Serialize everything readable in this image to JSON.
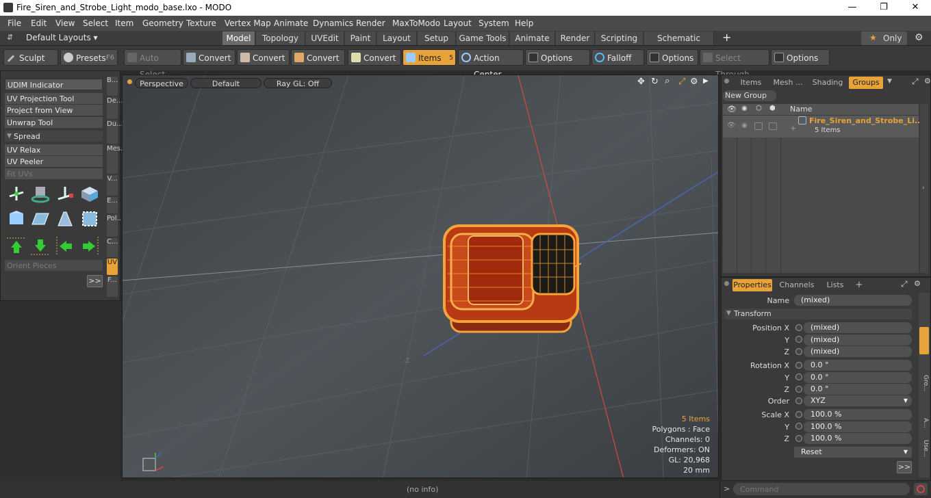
{
  "window": {
    "title": "Fire_Siren_and_Strobe_Light_modo_base.lxo - MODO",
    "min": "—",
    "max": "❐",
    "close": "✕"
  },
  "menu": [
    "File",
    "Edit",
    "View",
    "Select",
    "Item",
    "Geometry",
    "Texture",
    "Vertex Map",
    "Animate",
    "Dynamics",
    "Render",
    "MaxToModo",
    "Layout",
    "System",
    "Help"
  ],
  "layouts": {
    "label": "Default Layouts ▾",
    "tabs": [
      "Model",
      "Topology",
      "UVEdit",
      "Paint",
      "Layout",
      "Setup",
      "Game Tools",
      "Animate",
      "Render",
      "Scripting",
      "Schematic Fusion"
    ],
    "plus": "+",
    "only": "Only",
    "star": "★"
  },
  "toolbar": {
    "sculpt": "Sculpt",
    "presets": "Presets",
    "presets_key": "F6",
    "auto_select": "Auto Select",
    "convert": "Convert",
    "items": "Items",
    "items_key": "5",
    "action_center": "Action Center",
    "options": "Options",
    "falloff": "Falloff",
    "select_through": "Select Through"
  },
  "left": {
    "buttons": [
      "UDIM Indicator",
      "UV Projection Tool",
      "Project from View",
      "Unwrap Tool"
    ],
    "spread": "Spread",
    "buttons2": [
      "UV Relax",
      "UV Peeler",
      "Fit UVs"
    ],
    "orient": "Orient Pieces",
    "more": ">>",
    "vtabs": [
      "B...",
      "De...",
      "Du...",
      "Mes...",
      "V...",
      "E...",
      "Pol...",
      "C...",
      "UV",
      "F..."
    ]
  },
  "viewport": {
    "perspective": "Perspective",
    "default": "Default",
    "raygl": "Ray GL: Off",
    "hud": {
      "items": "5 Items",
      "polygons": "Polygons : Face",
      "channels": "Channels: 0",
      "deformers": "Deformers: ON",
      "gl": "GL: 20,968",
      "scale": "20 mm"
    }
  },
  "status": {
    "info": "(no info)"
  },
  "items_panel": {
    "tabs": [
      "Items",
      "Mesh ...",
      "Shading",
      "Groups"
    ],
    "new_group": "New Group",
    "col_name": "Name",
    "group_name": "Fire_Siren_and_Strobe_Li...",
    "group_count": "5 Items"
  },
  "props": {
    "tabs": [
      "Properties",
      "Channels",
      "Lists",
      "+"
    ],
    "name_label": "Name",
    "name_value": "(mixed)",
    "transform": "Transform",
    "position_label": "Position X",
    "y": "Y",
    "z": "Z",
    "pos": [
      "(mixed)",
      "(mixed)",
      "(mixed)"
    ],
    "rotation_label": "Rotation X",
    "rot": [
      "0.0 °",
      "0.0 °",
      "0.0 °"
    ],
    "order_label": "Order",
    "order": "XYZ",
    "scale_label": "Scale X",
    "scale": [
      "100.0 %",
      "100.0 %",
      "100.0 %"
    ],
    "reset": "Reset",
    "more": ">>",
    "side_tabs": [
      "Gro...",
      "A...",
      "Use..."
    ]
  },
  "command": {
    "prompt": ">",
    "placeholder": "Command"
  }
}
